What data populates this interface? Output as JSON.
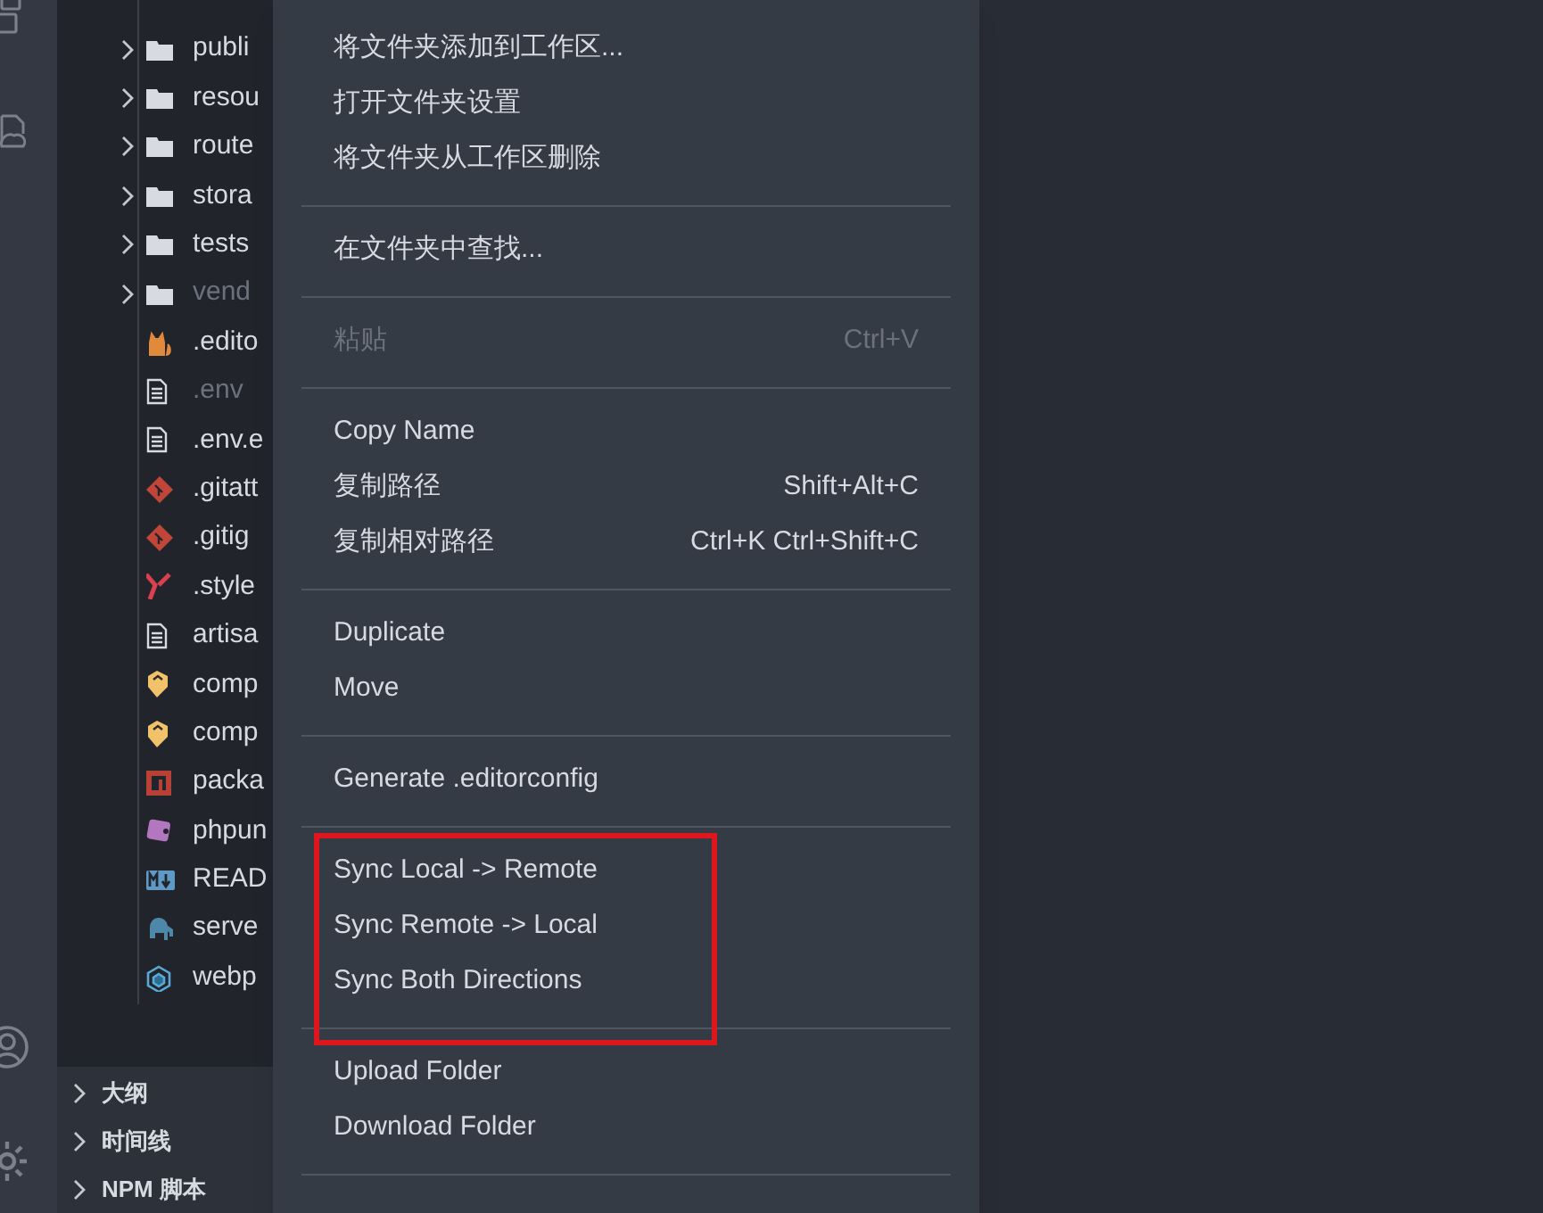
{
  "explorer": {
    "rows": [
      {
        "name": "publi",
        "kind": "folder",
        "ignored": false
      },
      {
        "name": "resou",
        "kind": "folder",
        "ignored": false
      },
      {
        "name": "route",
        "kind": "folder",
        "ignored": false
      },
      {
        "name": "stora",
        "kind": "folder",
        "ignored": false
      },
      {
        "name": "tests",
        "kind": "folder",
        "ignored": false
      },
      {
        "name": "vend",
        "kind": "folder",
        "ignored": true
      },
      {
        "name": ".edito",
        "kind": "cat",
        "ignored": false
      },
      {
        "name": ".env",
        "kind": "document",
        "ignored": true
      },
      {
        "name": ".env.e",
        "kind": "document",
        "ignored": false
      },
      {
        "name": ".gitatt",
        "kind": "git",
        "ignored": false
      },
      {
        "name": ".gitig",
        "kind": "git",
        "ignored": false
      },
      {
        "name": ".style",
        "kind": "yaml",
        "ignored": false
      },
      {
        "name": "artisa",
        "kind": "document",
        "ignored": false
      },
      {
        "name": "comp",
        "kind": "composer",
        "ignored": false
      },
      {
        "name": "comp",
        "kind": "composer",
        "ignored": false
      },
      {
        "name": "packa",
        "kind": "npm",
        "ignored": false
      },
      {
        "name": "phpun",
        "kind": "phpunit",
        "ignored": false
      },
      {
        "name": "READ",
        "kind": "markdown",
        "ignored": false
      },
      {
        "name": "serve",
        "kind": "elephant",
        "ignored": false
      },
      {
        "name": "webp",
        "kind": "cube",
        "ignored": false
      }
    ]
  },
  "sections": [
    {
      "label": "大纲",
      "expanded": false
    },
    {
      "label": "时间线",
      "expanded": false
    },
    {
      "label": "NPM 脚本",
      "expanded": false
    }
  ],
  "context_menu": {
    "groups": [
      {
        "highlighted": false,
        "items": [
          {
            "label": "将文件夹添加到工作区...",
            "disabled": false
          },
          {
            "label": "打开文件夹设置",
            "disabled": false
          },
          {
            "label": "将文件夹从工作区删除",
            "disabled": false
          }
        ]
      },
      {
        "highlighted": false,
        "items": [
          {
            "label": "在文件夹中查找...",
            "disabled": false
          }
        ]
      },
      {
        "highlighted": false,
        "items": [
          {
            "label": "粘贴",
            "shortcut": "Ctrl+V",
            "disabled": true
          }
        ]
      },
      {
        "highlighted": false,
        "items": [
          {
            "label": "Copy Name",
            "disabled": false
          },
          {
            "label": "复制路径",
            "shortcut": "Shift+Alt+C",
            "disabled": false
          },
          {
            "label": "复制相对路径",
            "shortcut": "Ctrl+K Ctrl+Shift+C",
            "disabled": false
          }
        ]
      },
      {
        "highlighted": false,
        "items": [
          {
            "label": "Duplicate",
            "disabled": false
          },
          {
            "label": "Move",
            "disabled": false
          }
        ]
      },
      {
        "highlighted": false,
        "items": [
          {
            "label": "Generate .editorconfig",
            "disabled": false
          }
        ]
      },
      {
        "highlighted": true,
        "items": [
          {
            "label": "Sync Local -> Remote",
            "disabled": false
          },
          {
            "label": "Sync Remote -> Local",
            "disabled": false
          },
          {
            "label": "Sync Both Directions",
            "disabled": false
          }
        ]
      },
      {
        "highlighted": false,
        "items": [
          {
            "label": "Upload Folder",
            "disabled": false
          },
          {
            "label": "Download Folder",
            "disabled": false
          }
        ]
      }
    ]
  }
}
